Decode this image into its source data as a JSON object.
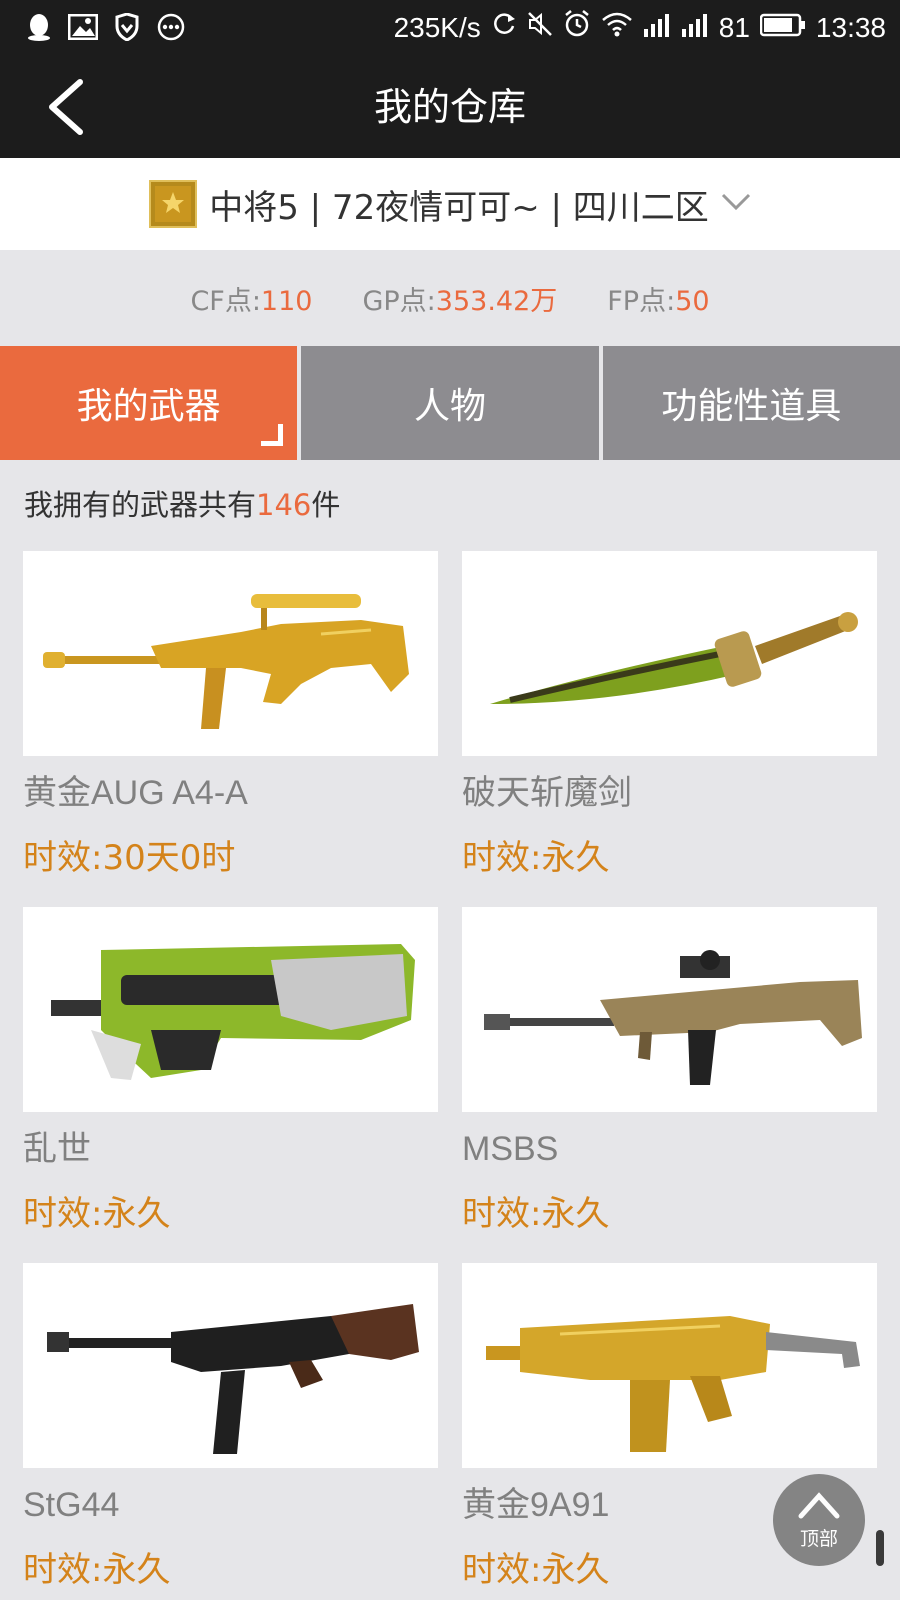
{
  "status_bar": {
    "left_icons": [
      "qq-icon",
      "image-icon",
      "shield-icon",
      "more-icon"
    ],
    "speed": "235K/s",
    "battery": "81",
    "time": "13:38"
  },
  "nav": {
    "title": "我的仓库"
  },
  "account": {
    "text": "中将5 | 72夜情可可~ | 四川二区"
  },
  "points": [
    {
      "label": "CF点:",
      "value": "110"
    },
    {
      "label": "GP点:",
      "value": "353.42万"
    },
    {
      "label": "FP点:",
      "value": "50"
    }
  ],
  "tabs": [
    {
      "label": "我的武器",
      "active": true
    },
    {
      "label": "人物",
      "active": false
    },
    {
      "label": "功能性道具",
      "active": false
    }
  ],
  "summary": {
    "prefix": "我拥有的武器共有",
    "count": "146",
    "suffix": "件"
  },
  "weapons": [
    {
      "name": "黄金AUG A4-A",
      "time": "时效:30天0时",
      "icon": "gold-rifle"
    },
    {
      "name": "破天斩魔剑",
      "time": "时效:永久",
      "icon": "sword"
    },
    {
      "name": "乱世",
      "time": "时效:永久",
      "icon": "smg-green"
    },
    {
      "name": "MSBS",
      "time": "时效:永久",
      "icon": "rifle-tan"
    },
    {
      "name": "StG44",
      "time": "时效:永久",
      "icon": "rifle-black"
    },
    {
      "name": "黄金9A91",
      "time": "时效:永久",
      "icon": "gold-carbine"
    }
  ],
  "top_button": {
    "label": "顶部"
  },
  "colors": {
    "accent": "#ea6a3e",
    "time_text": "#d4831a",
    "tab_inactive": "#8d8c90",
    "bar_bg": "#1c1c1c"
  }
}
